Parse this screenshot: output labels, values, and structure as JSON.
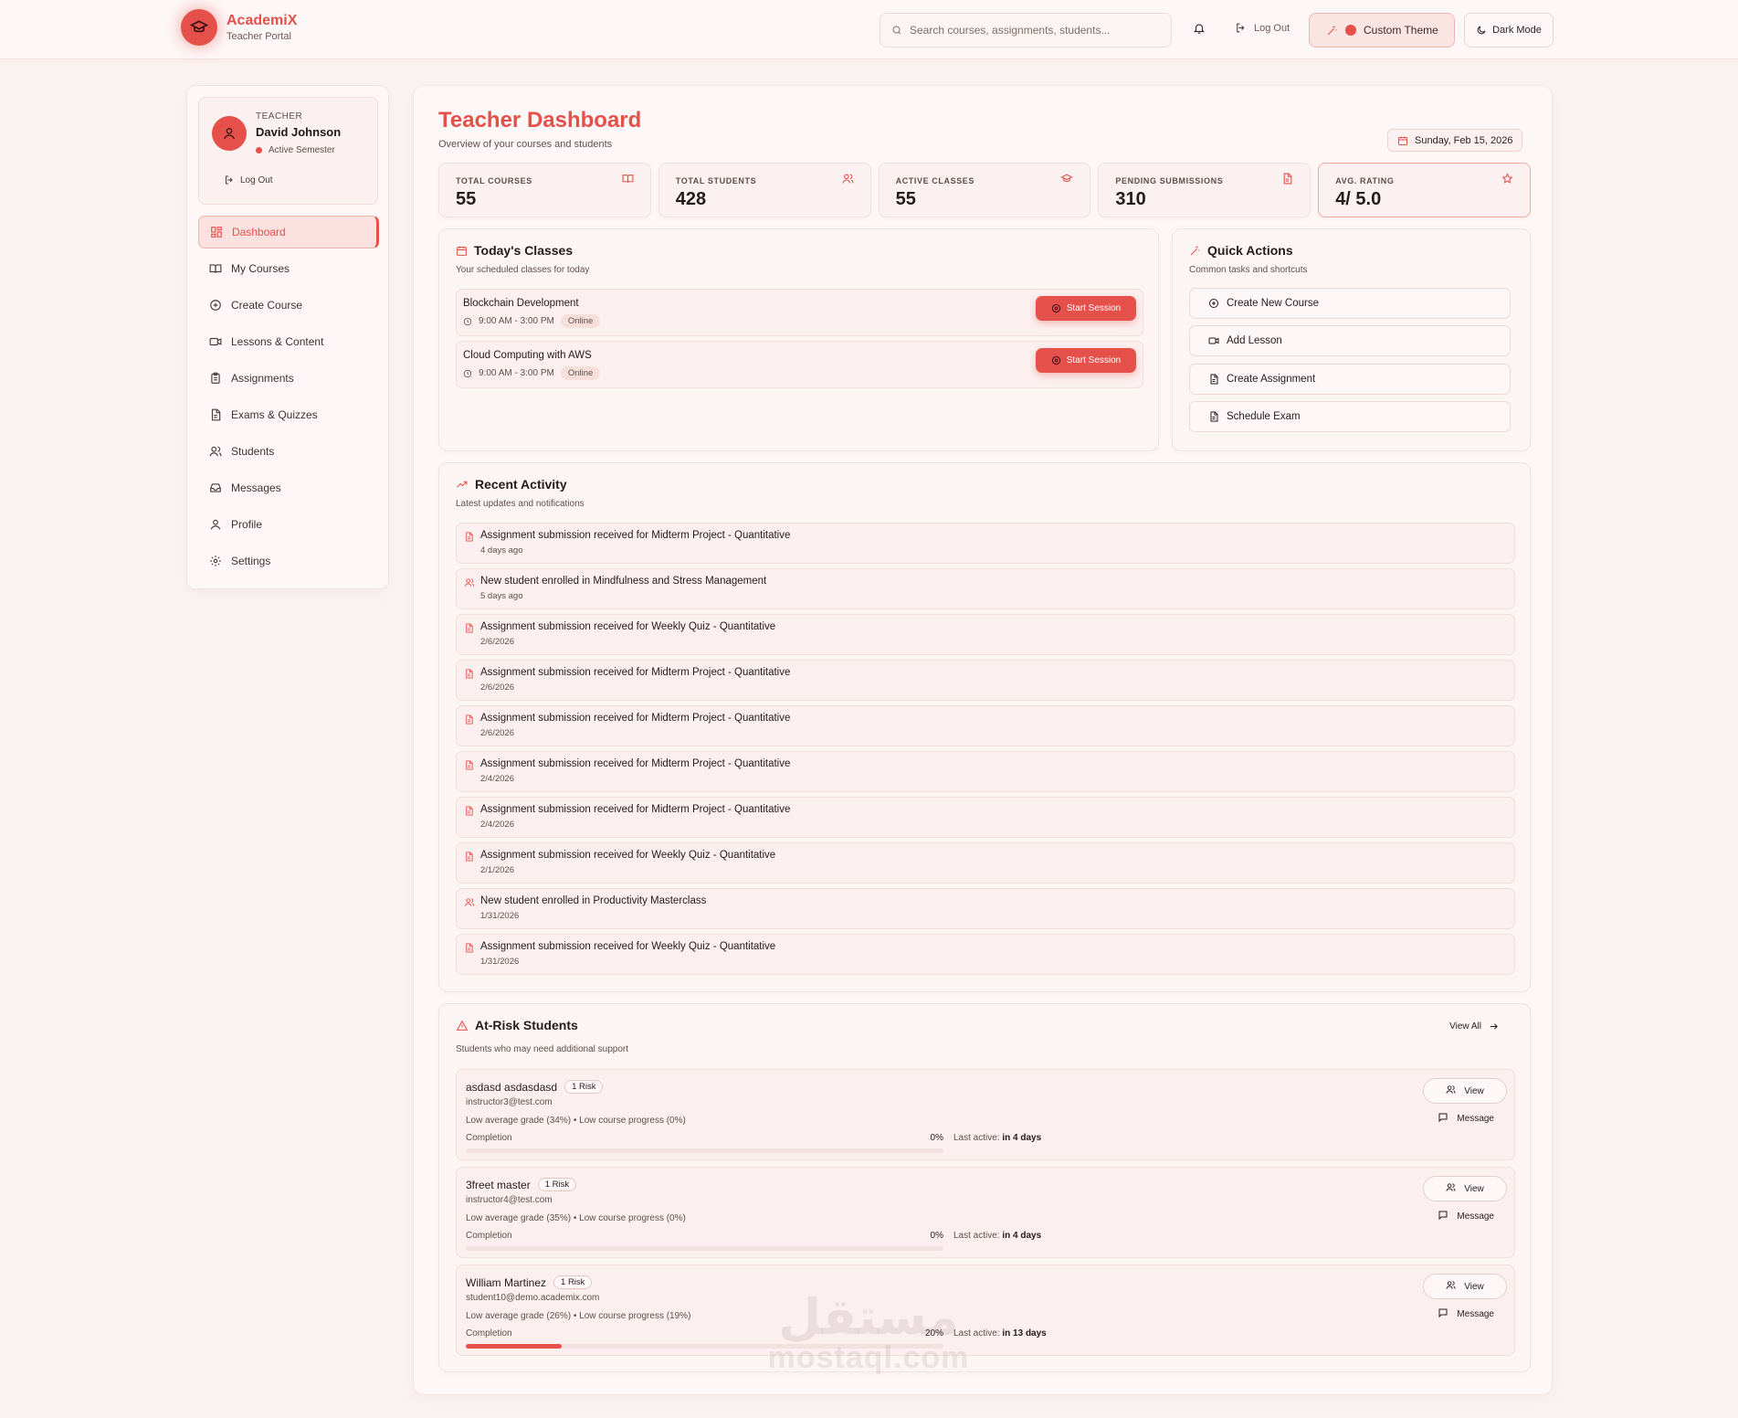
{
  "header": {
    "app_name": "AcademiX",
    "app_sub": "Teacher Portal",
    "search_placeholder": "Search courses, assignments, students...",
    "logout_label": "Log Out",
    "custom_theme_label": "Custom Theme",
    "dark_mode_label": "Dark Mode"
  },
  "colors": {
    "accent": "#e6504a",
    "background": "#fbf3f2",
    "card": "#fcf5f4"
  },
  "sidebar": {
    "profile": {
      "role": "TEACHER",
      "name": "David Johnson",
      "status": "Active Semester",
      "logout_label": "Log Out"
    },
    "items": [
      {
        "label": "Dashboard",
        "icon": "dashboard-icon"
      },
      {
        "label": "My Courses",
        "icon": "book-icon"
      },
      {
        "label": "Create Course",
        "icon": "plus-circle-icon"
      },
      {
        "label": "Lessons & Content",
        "icon": "video-icon"
      },
      {
        "label": "Assignments",
        "icon": "clipboard-icon"
      },
      {
        "label": "Exams & Quizzes",
        "icon": "document-icon"
      },
      {
        "label": "Students",
        "icon": "users-icon"
      },
      {
        "label": "Messages",
        "icon": "inbox-icon"
      },
      {
        "label": "Profile",
        "icon": "user-icon"
      },
      {
        "label": "Settings",
        "icon": "gear-icon"
      }
    ]
  },
  "main": {
    "title": "Teacher Dashboard",
    "subtitle": "Overview of your courses and students",
    "date": "Sunday, Feb 15, 2026",
    "stats": [
      {
        "label": "TOTAL COURSES",
        "value": "55",
        "icon": "book-icon"
      },
      {
        "label": "TOTAL STUDENTS",
        "value": "428",
        "icon": "users-icon"
      },
      {
        "label": "ACTIVE CLASSES",
        "value": "55",
        "icon": "graduation-cap-icon"
      },
      {
        "label": "PENDING SUBMISSIONS",
        "value": "310",
        "icon": "document-icon"
      },
      {
        "label": "AVG. RATING",
        "value": "4/ 5.0",
        "icon": "star-icon"
      }
    ],
    "todays_classes": {
      "title": "Today's Classes",
      "subtitle": "Your scheduled classes for today",
      "items": [
        {
          "name": "Blockchain Development",
          "time": "9:00 AM - 3:00 PM",
          "mode": "Online",
          "action": "Start Session"
        },
        {
          "name": "Cloud Computing with AWS",
          "time": "9:00 AM - 3:00 PM",
          "mode": "Online",
          "action": "Start Session"
        }
      ]
    },
    "quick_actions": {
      "title": "Quick Actions",
      "subtitle": "Common tasks and shortcuts",
      "items": [
        {
          "label": "Create New Course",
          "icon": "plus-circle-icon"
        },
        {
          "label": "Add Lesson",
          "icon": "video-icon"
        },
        {
          "label": "Create Assignment",
          "icon": "document-icon"
        },
        {
          "label": "Schedule Exam",
          "icon": "document-icon"
        }
      ]
    },
    "recent_activity": {
      "title": "Recent Activity",
      "subtitle": "Latest updates and notifications",
      "items": [
        {
          "text": "Assignment submission received for Midterm Project - Quantitative",
          "time": "4 days ago",
          "icon": "document-icon"
        },
        {
          "text": "New student enrolled in Mindfulness and Stress Management",
          "time": "5 days ago",
          "icon": "users-icon"
        },
        {
          "text": "Assignment submission received for Weekly Quiz - Quantitative",
          "time": "2/6/2026",
          "icon": "document-icon"
        },
        {
          "text": "Assignment submission received for Midterm Project - Quantitative",
          "time": "2/6/2026",
          "icon": "document-icon"
        },
        {
          "text": "Assignment submission received for Midterm Project - Quantitative",
          "time": "2/6/2026",
          "icon": "document-icon"
        },
        {
          "text": "Assignment submission received for Midterm Project - Quantitative",
          "time": "2/4/2026",
          "icon": "document-icon"
        },
        {
          "text": "Assignment submission received for Midterm Project - Quantitative",
          "time": "2/4/2026",
          "icon": "document-icon"
        },
        {
          "text": "Assignment submission received for Weekly Quiz - Quantitative",
          "time": "2/1/2026",
          "icon": "document-icon"
        },
        {
          "text": "New student enrolled in Productivity Masterclass",
          "time": "1/31/2026",
          "icon": "users-icon"
        },
        {
          "text": "Assignment submission received for Weekly Quiz - Quantitative",
          "time": "1/31/2026",
          "icon": "document-icon"
        }
      ]
    },
    "at_risk": {
      "title": "At-Risk Students",
      "subtitle": "Students who may need additional support",
      "view_all": "View All",
      "completion_label": "Completion",
      "last_active_label": "Last active:",
      "view_label": "View",
      "message_label": "Message",
      "students": [
        {
          "name": "asdasd asdasdasd",
          "badge": "1 Risk",
          "email": "instructor3@test.com",
          "reason": "Low average grade (34%) • Low course progress (0%)",
          "completion": 0,
          "completion_text": "0%",
          "last_active": "in 4 days"
        },
        {
          "name": "3freet master",
          "badge": "1 Risk",
          "email": "instructor4@test.com",
          "reason": "Low average grade (35%) • Low course progress (0%)",
          "completion": 0,
          "completion_text": "0%",
          "last_active": "in 4 days"
        },
        {
          "name": "William Martinez",
          "badge": "1 Risk",
          "email": "student10@demo.academix.com",
          "reason": "Low average grade (26%) • Low course progress (19%)",
          "completion": 20,
          "completion_text": "20%",
          "last_active": "in 13 days"
        }
      ]
    }
  },
  "watermark": {
    "arabic": "مستقل",
    "latin": "mostaql.com"
  }
}
